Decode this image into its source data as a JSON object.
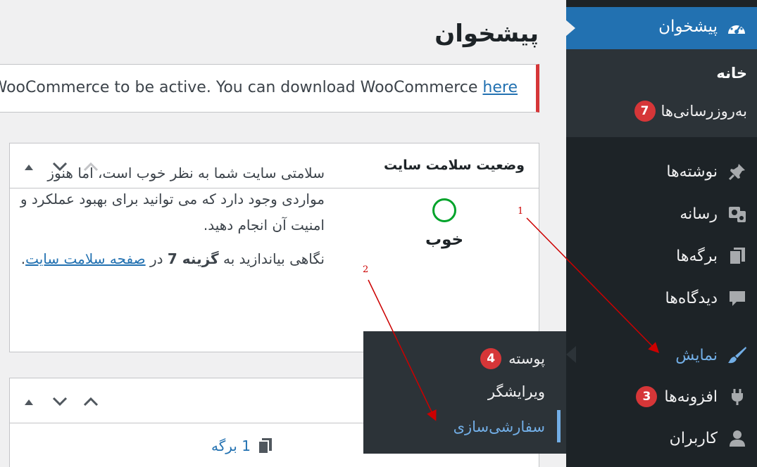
{
  "page": {
    "title": "پیشخوان"
  },
  "notice": {
    "text": "uires WooCommerce to be active. You can download WooCommerce ",
    "link": "here"
  },
  "sidebar": {
    "dashboard": {
      "label": "پیشخوان",
      "icon": "dashboard-icon"
    },
    "submenu": {
      "home": "خانه",
      "updates": {
        "label": "به‌روزرسانی‌ها",
        "badge": "7"
      }
    },
    "items": [
      {
        "label": "نوشته‌ها",
        "icon": "pin-icon"
      },
      {
        "label": "رسانه",
        "icon": "media-icon"
      },
      {
        "label": "برگه‌ها",
        "icon": "pages-icon"
      },
      {
        "label": "دیدگاه‌ها",
        "icon": "comment-icon"
      },
      {
        "label": "نمایش",
        "icon": "appearance-icon",
        "active": true
      },
      {
        "label": "افزونه‌ها",
        "icon": "plugins-icon",
        "badge": "3"
      },
      {
        "label": "کاربران",
        "icon": "users-icon"
      }
    ]
  },
  "flyout": {
    "items": [
      {
        "label": "پوسته",
        "badge": "4"
      },
      {
        "label": "ویرایشگر"
      },
      {
        "label": "سفارشی‌سازی"
      }
    ]
  },
  "health_panel": {
    "title": "وضعیت سلامت سایت",
    "status": "خوب",
    "description": "سلامتی سایت شما به نظر خوب است، اما هنوز مواردی وجود دارد که می توانید برای بهبود عملکرد و امنیت آن انجام دهید.",
    "more_prefix": "نگاهی بیاندازید به ",
    "more_bold": "گزینه 7",
    "more_mid": " در ",
    "more_link": "صفحه سلامت سایت",
    "more_suffix": "."
  },
  "glance_panel": {
    "pages": "1 برگه"
  },
  "annotations": {
    "one": "1",
    "two": "2"
  },
  "colors": {
    "sidebar": "#1d2327",
    "active": "#2271b1",
    "highlight": "#72aee6",
    "badge": "#d63638",
    "health": "#00a32a",
    "arrow": "#cc0000"
  }
}
